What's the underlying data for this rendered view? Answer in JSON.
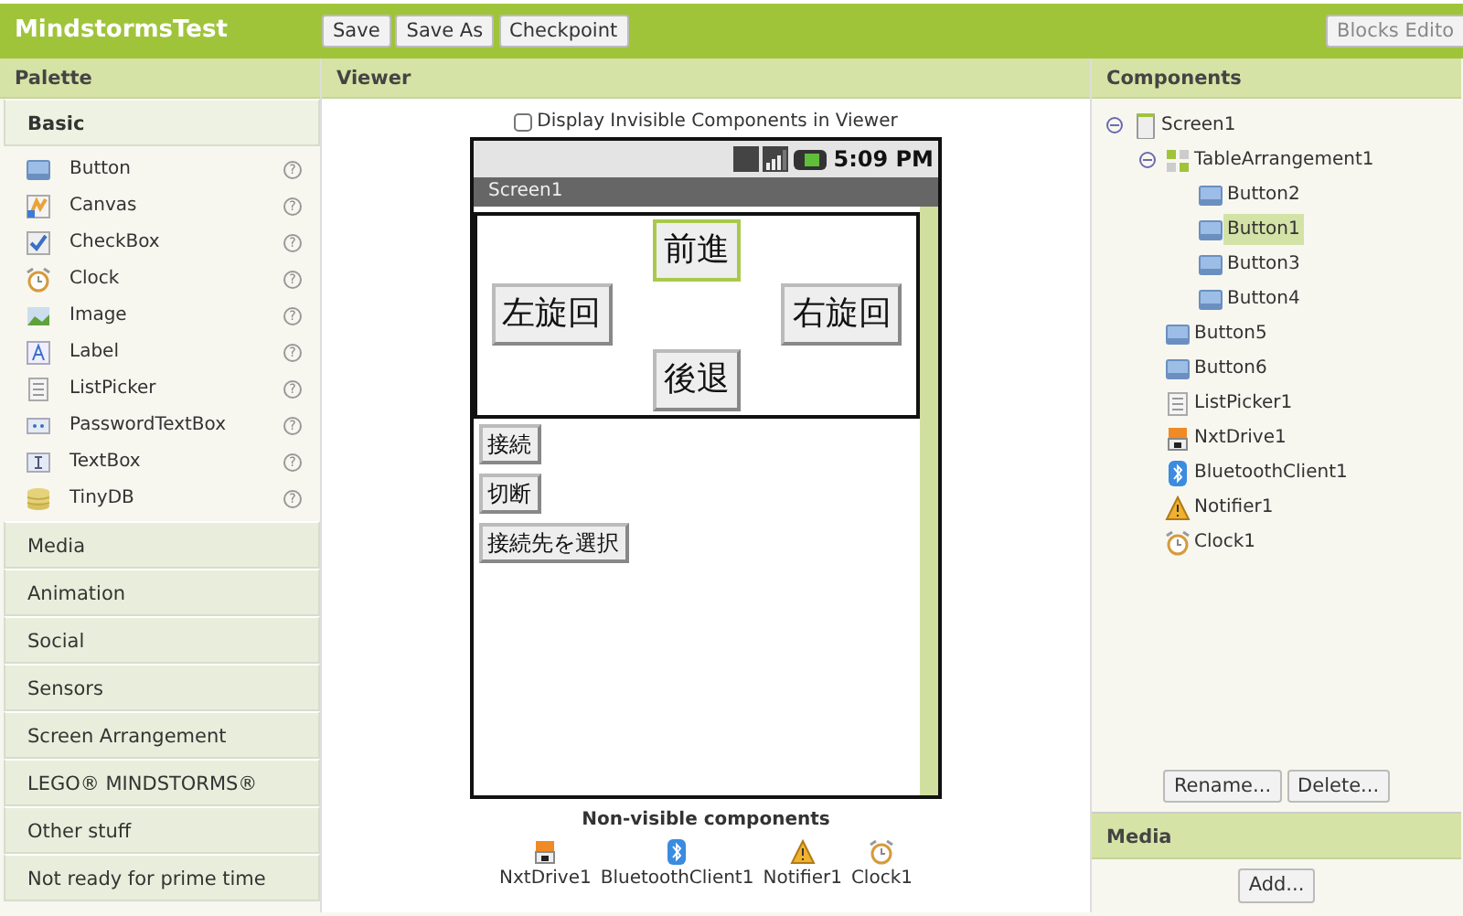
{
  "topbar": {
    "title": "MindstormsTest",
    "buttons": [
      "Save",
      "Save As",
      "Checkpoint"
    ],
    "right_button": "Blocks Edito"
  },
  "palette": {
    "title": "Palette",
    "sections": [
      {
        "label": "Basic",
        "expanded": true,
        "items": [
          {
            "label": "Button",
            "kind": "button",
            "help": "?"
          },
          {
            "label": "Canvas",
            "kind": "canvas",
            "help": "?"
          },
          {
            "label": "CheckBox",
            "kind": "checkbox",
            "help": "?"
          },
          {
            "label": "Clock",
            "kind": "clock",
            "help": "?"
          },
          {
            "label": "Image",
            "kind": "image",
            "help": "?"
          },
          {
            "label": "Label",
            "kind": "label",
            "help": "?"
          },
          {
            "label": "ListPicker",
            "kind": "listpicker",
            "help": "?"
          },
          {
            "label": "PasswordTextBox",
            "kind": "password",
            "help": "?"
          },
          {
            "label": "TextBox",
            "kind": "textbox",
            "help": "?"
          },
          {
            "label": "TinyDB",
            "kind": "tinydb",
            "help": "?"
          }
        ]
      },
      {
        "label": "Media",
        "expanded": false
      },
      {
        "label": "Animation",
        "expanded": false
      },
      {
        "label": "Social",
        "expanded": false
      },
      {
        "label": "Sensors",
        "expanded": false
      },
      {
        "label": "Screen Arrangement",
        "expanded": false
      },
      {
        "label": "LEGO® MINDSTORMS®",
        "expanded": false
      },
      {
        "label": "Other stuff",
        "expanded": false
      },
      {
        "label": "Not ready for prime time",
        "expanded": false
      }
    ]
  },
  "viewer": {
    "title": "Viewer",
    "display_invisible": {
      "label": "Display Invisible Components in Viewer",
      "checked": false
    },
    "phone": {
      "time": "5:09 PM",
      "screen_title": "Screen1",
      "table_arrangement": {
        "rows": [
          [
            {
              "kind": "empty"
            },
            {
              "kind": "button",
              "label": "前進",
              "selected": true
            },
            {
              "kind": "empty"
            }
          ],
          [
            {
              "kind": "button",
              "label": "左旋回",
              "selected": false
            },
            {
              "kind": "empty"
            },
            {
              "kind": "button",
              "label": "右旋回",
              "selected": false
            }
          ],
          [
            {
              "kind": "empty"
            },
            {
              "kind": "button",
              "label": "後退",
              "selected": false
            },
            {
              "kind": "empty"
            }
          ]
        ]
      },
      "buttons": [
        "接続",
        "切断",
        "接続先を選択"
      ]
    },
    "nonvisible_title": "Non-visible components",
    "nonvisible": [
      {
        "label": "NxtDrive1",
        "kind": "nxt"
      },
      {
        "label": "BluetoothClient1",
        "kind": "bluetooth"
      },
      {
        "label": "Notifier1",
        "kind": "notifier"
      },
      {
        "label": "Clock1",
        "kind": "clock"
      }
    ]
  },
  "components": {
    "title": "Components",
    "tree": [
      {
        "label": "Screen1",
        "kind": "screen",
        "expanded": true,
        "selected": false,
        "children": [
          {
            "label": "TableArrangement1",
            "kind": "arrangement",
            "expanded": true,
            "selected": false,
            "children": [
              {
                "label": "Button2",
                "kind": "button",
                "selected": false
              },
              {
                "label": "Button1",
                "kind": "button",
                "selected": true
              },
              {
                "label": "Button3",
                "kind": "button",
                "selected": false
              },
              {
                "label": "Button4",
                "kind": "button",
                "selected": false
              }
            ]
          },
          {
            "label": "Button5",
            "kind": "button",
            "selected": false
          },
          {
            "label": "Button6",
            "kind": "button",
            "selected": false
          },
          {
            "label": "ListPicker1",
            "kind": "listpicker",
            "selected": false
          },
          {
            "label": "NxtDrive1",
            "kind": "nxt",
            "selected": false
          },
          {
            "label": "BluetoothClient1",
            "kind": "bluetooth",
            "selected": false
          },
          {
            "label": "Notifier1",
            "kind": "notifier",
            "selected": false
          },
          {
            "label": "Clock1",
            "kind": "clock",
            "selected": false
          }
        ]
      }
    ],
    "buttons": [
      "Rename...",
      "Delete..."
    ]
  },
  "media": {
    "title": "Media",
    "button": "Add..."
  }
}
